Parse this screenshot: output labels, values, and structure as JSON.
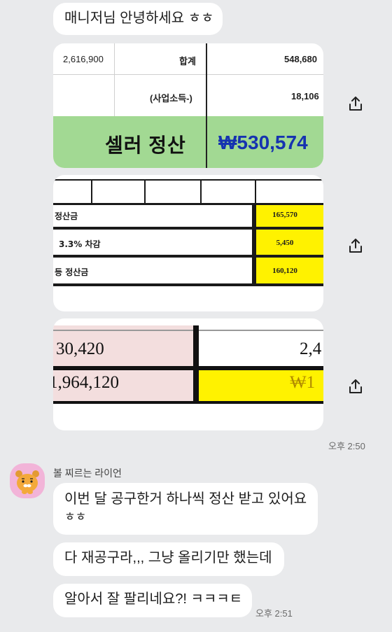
{
  "messages_top": {
    "greeting": "매니저님 안녕하세요 ㅎㅎ",
    "time": "오후 2:50"
  },
  "image1": {
    "row1_left": "2,616,900",
    "row1_label": "합계",
    "row1_value": "548,680",
    "row2_label": "(사업소득-)",
    "row2_value": "18,106",
    "total_label": "셀러 정산",
    "total_value": "₩530,574"
  },
  "image2": {
    "rows": [
      {
        "label": "정산금",
        "value": "165,570"
      },
      {
        "label": "3.3% 차감",
        "value": "5,450"
      },
      {
        "label": "등 정산금",
        "value": "160,120"
      }
    ]
  },
  "image3": {
    "row1_left": "30,420",
    "row1_right": "2,4",
    "row2_left": "1,964,120",
    "row2_right": "₩1"
  },
  "friend": {
    "name": "볼 찌르는 라이언",
    "msg1_line1": "이번 달 공구한거 하나씩 정산 받고 있어요",
    "msg1_line2": "ㅎㅎ",
    "msg2": "다 재공구라,,, 그냥 올리기만 했는데",
    "msg3": "알아서 잘 팔리네요?! ㅋㅋㅋㅌ",
    "time": "오후 2:51"
  },
  "colors": {
    "background": "#e9eaec",
    "bubble": "#ffffff",
    "settle_green": "#a2d993",
    "settle_amount_blue": "#1633b0",
    "highlight_yellow": "#fff200",
    "avatar_pink": "#f2b4d8"
  },
  "icons": [
    "share-icon",
    "ryan-avatar"
  ]
}
